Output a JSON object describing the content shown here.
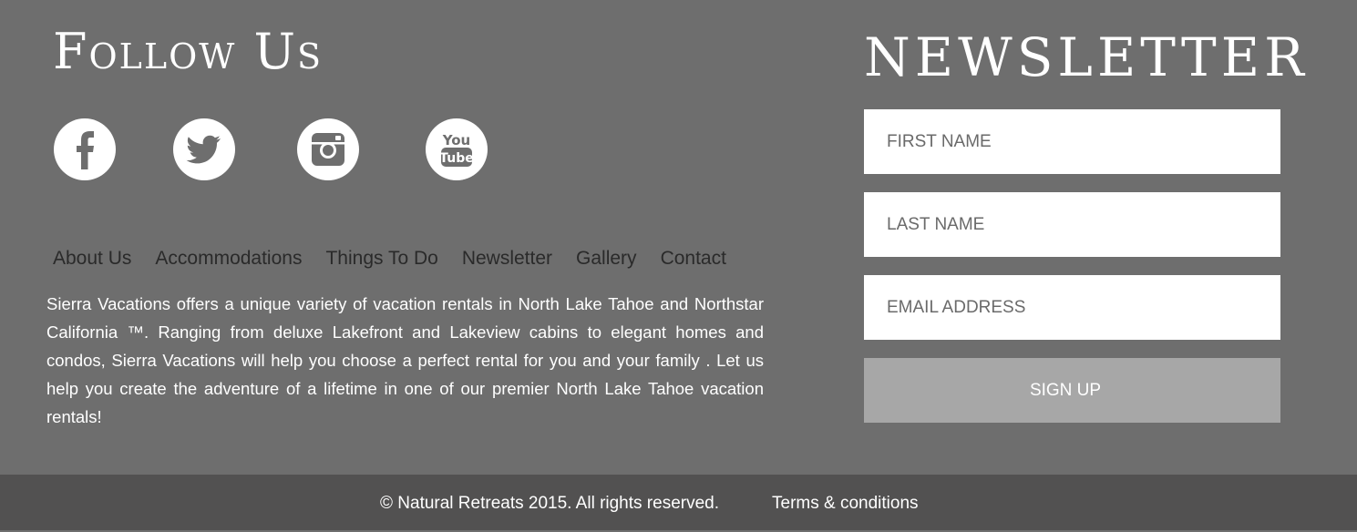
{
  "follow": {
    "title": "Follow Us",
    "icons": [
      "facebook-icon",
      "twitter-icon",
      "instagram-icon",
      "youtube-icon"
    ],
    "youtube_text_top": "You",
    "youtube_text_bottom": "Tube"
  },
  "nav": {
    "items": [
      "About Us",
      "Accommodations",
      "Things To Do",
      "Newsletter",
      "Gallery",
      "Contact"
    ]
  },
  "about": {
    "text": "Sierra Vacations offers a unique variety of vacation rentals in North Lake Tahoe and Northstar California ™. Ranging from deluxe Lakefront and Lakeview cabins to elegant homes and condos, Sierra Vacations will help you choose a perfect rental for you and your family . Let us help you create the adventure of a lifetime in one of our premier North Lake Tahoe vacation rentals!"
  },
  "newsletter": {
    "title": "NEWSLETTER",
    "first_name_placeholder": "FIRST NAME",
    "last_name_placeholder": "LAST NAME",
    "email_placeholder": "EMAIL ADDRESS",
    "signup_label": "SIGN UP"
  },
  "footer": {
    "copyright": "© Natural Retreats 2015. All rights reserved.",
    "terms": "Terms & conditions"
  },
  "colors": {
    "background": "#6e6e6e",
    "bottom_bar": "#525151",
    "signup_button": "#a7a7a7",
    "icon_glyph": "#6e6e6e"
  }
}
